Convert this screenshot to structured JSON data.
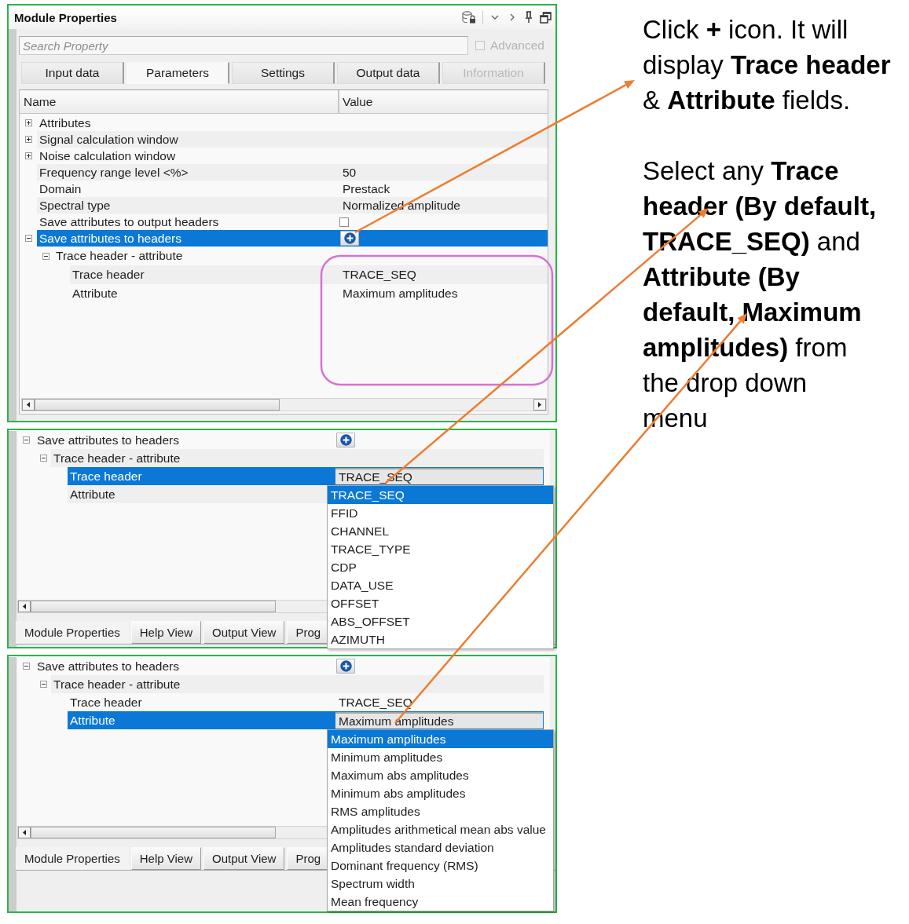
{
  "screens": [
    {
      "kind": "properties_window",
      "title": "Module Properties",
      "search": {
        "placeholder": "Search Property"
      },
      "advanced": {
        "label": "Advanced",
        "checked": false,
        "disabled": true
      },
      "tabs": [
        {
          "label": "Input data",
          "selected": false,
          "disabled": false
        },
        {
          "label": "Parameters",
          "selected": true,
          "disabled": false
        },
        {
          "label": "Settings",
          "selected": false,
          "disabled": false
        },
        {
          "label": "Output data",
          "selected": false,
          "disabled": false
        },
        {
          "label": "Information",
          "selected": false,
          "disabled": true
        }
      ],
      "columns": [
        "Name",
        "Value"
      ],
      "rows": [
        {
          "name": "Attributes",
          "expanded": false,
          "selected": false
        },
        {
          "name": "Signal calculation window",
          "expanded": false,
          "selected": false
        },
        {
          "name": "Noise calculation window",
          "expanded": false,
          "selected": false
        },
        {
          "name": "Frequency range level <%>",
          "kind": "text",
          "value": "50",
          "selected": false
        },
        {
          "name": "Domain",
          "kind": "text",
          "value": "Prestack",
          "selected": false
        },
        {
          "name": "Spectral type",
          "kind": "text",
          "value": "Normalized amplitude",
          "selected": false
        },
        {
          "name": "Save attributes to output headers",
          "kind": "checkbox",
          "checked": false,
          "selected": false
        },
        {
          "name": "Save attributes to headers",
          "kind": "add_button",
          "expanded": true,
          "selected": true,
          "children": [
            {
              "name": "Trace header - attribute",
              "expanded": true,
              "selected": false,
              "children": [
                {
                  "name": "Trace header",
                  "kind": "text",
                  "value": "TRACE_SEQ",
                  "selected": false
                },
                {
                  "name": "Attribute",
                  "kind": "text",
                  "value": "Maximum amplitudes",
                  "selected": false
                }
              ]
            }
          ]
        }
      ]
    },
    {
      "kind": "dropdown_view",
      "rows": [
        {
          "name": "Save attributes to headers",
          "kind": "add_button",
          "expanded": true,
          "selected": false,
          "children": [
            {
              "name": "Trace header - attribute",
              "expanded": true,
              "selected": false,
              "children": [
                {
                  "name": "Trace header",
                  "kind": "combo",
                  "value": "TRACE_SEQ",
                  "selected": true,
                  "options": [
                    {
                      "label": "TRACE_SEQ",
                      "selected": true
                    },
                    {
                      "label": "FFID",
                      "selected": false
                    },
                    {
                      "label": "CHANNEL",
                      "selected": false
                    },
                    {
                      "label": "TRACE_TYPE",
                      "selected": false
                    },
                    {
                      "label": "CDP",
                      "selected": false
                    },
                    {
                      "label": "DATA_USE",
                      "selected": false
                    },
                    {
                      "label": "OFFSET",
                      "selected": false
                    },
                    {
                      "label": "ABS_OFFSET",
                      "selected": false
                    },
                    {
                      "label": "AZIMUTH",
                      "selected": false
                    }
                  ]
                },
                {
                  "name": "Attribute",
                  "selected": false
                }
              ]
            }
          ]
        }
      ],
      "bottom_tabs": [
        {
          "label": "Module Properties",
          "selected": true
        },
        {
          "label": "Help View",
          "selected": false
        },
        {
          "label": "Output View",
          "selected": false
        },
        {
          "label": "Prog",
          "selected": false
        }
      ]
    },
    {
      "kind": "dropdown_view",
      "rows": [
        {
          "name": "Save attributes to headers",
          "kind": "add_button",
          "expanded": true,
          "selected": false,
          "children": [
            {
              "name": "Trace header - attribute",
              "expanded": true,
              "selected": false,
              "children": [
                {
                  "name": "Trace header",
                  "kind": "text",
                  "value": "TRACE_SEQ",
                  "selected": false
                },
                {
                  "name": "Attribute",
                  "kind": "combo",
                  "value": "Maximum amplitudes",
                  "selected": true,
                  "options": [
                    {
                      "label": "Maximum amplitudes",
                      "selected": true
                    },
                    {
                      "label": "Minimum amplitudes",
                      "selected": false
                    },
                    {
                      "label": "Maximum abs amplitudes",
                      "selected": false
                    },
                    {
                      "label": "Minimum abs amplitudes",
                      "selected": false
                    },
                    {
                      "label": "RMS amplitudes",
                      "selected": false
                    },
                    {
                      "label": "Amplitudes arithmetical mean abs value",
                      "selected": false
                    },
                    {
                      "label": "Amplitudes standard deviation",
                      "selected": false
                    },
                    {
                      "label": "Dominant frequency (RMS)",
                      "selected": false
                    },
                    {
                      "label": "Spectrum width",
                      "selected": false
                    },
                    {
                      "label": "Mean frequency",
                      "selected": false
                    }
                  ]
                }
              ]
            }
          ]
        }
      ],
      "bottom_tabs": [
        {
          "label": "Module Properties",
          "selected": true
        },
        {
          "label": "Help View",
          "selected": false
        },
        {
          "label": "Output View",
          "selected": false
        },
        {
          "label": "Prog",
          "selected": false
        }
      ]
    }
  ],
  "annotation": {
    "paragraphs": [
      {
        "lines": [
          "Click **+** icon. It will",
          "display **Trace header**",
          "& **Attribute** fields."
        ]
      },
      {
        "lines": [
          "Select any **Trace**",
          "**header (By default,**",
          "**TRACE_SEQ)** and",
          "**Attribute (By**",
          "**default, Maximum**",
          "**amplitudes)** from",
          "the drop down",
          "menu"
        ]
      }
    ]
  }
}
